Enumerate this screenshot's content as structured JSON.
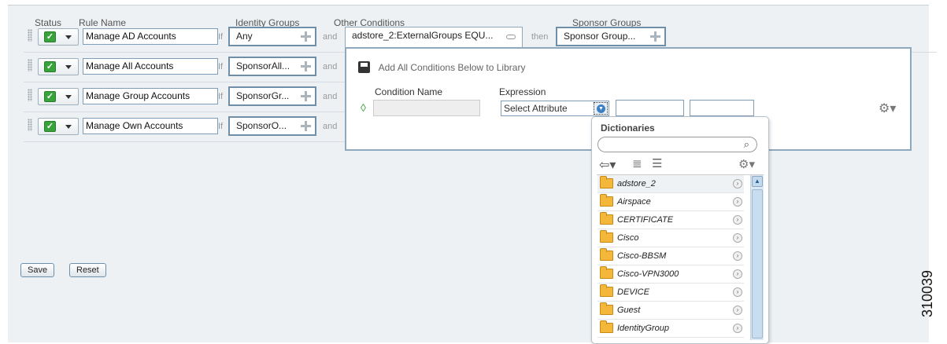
{
  "headers": {
    "status": "Status",
    "rule_name": "Rule Name",
    "identity_groups": "Identity Groups",
    "other_conditions": "Other Conditions",
    "sponsor_groups": "Sponsor Groups"
  },
  "keywords": {
    "if": "If",
    "and": "and",
    "then": "then"
  },
  "rules": [
    {
      "name": "Manage AD Accounts",
      "identity_group": "Any"
    },
    {
      "name": "Manage All Accounts",
      "identity_group": "SponsorAll..."
    },
    {
      "name": "Manage Group Accounts",
      "identity_group": "SponsorGr..."
    },
    {
      "name": "Manage Own Accounts",
      "identity_group": "SponsorO..."
    }
  ],
  "condition": "adstore_2:ExternalGroups EQU...",
  "sponsor_group": "Sponsor Group...",
  "popup": {
    "add_all_label": "Add All Conditions Below to Library",
    "condition_name_header": "Condition Name",
    "expression_header": "Expression",
    "condition_name_value": "",
    "select_attribute": "Select Attribute",
    "operator_value": "",
    "value_value": ""
  },
  "dictionaries": {
    "title": "Dictionaries",
    "search_placeholder": "",
    "items": [
      "adstore_2",
      "Airspace",
      "CERTIFICATE",
      "Cisco",
      "Cisco-BBSM",
      "Cisco-VPN3000",
      "DEVICE",
      "Guest",
      "IdentityGroup"
    ]
  },
  "buttons": {
    "save": "Save",
    "reset": "Reset"
  },
  "figure_id": "310039",
  "colors": {
    "accent_border": "#6f8ea8",
    "check_green": "#38a33a",
    "folder": "#f3b73a"
  }
}
